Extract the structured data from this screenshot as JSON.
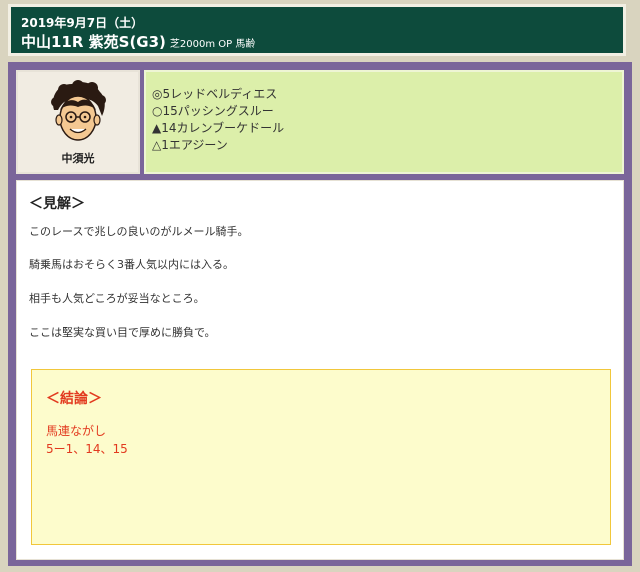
{
  "header": {
    "date": "2019年9月7日（土）",
    "race_title": "中山11R 紫苑S(G3)",
    "race_sub": "芝2000m OP 馬齢"
  },
  "tipster": {
    "name": "中須光"
  },
  "picks": [
    "◎5レッドベルディエス",
    "○15パッシングスルー",
    "▲14カレンブーケドール",
    "△1エアジーン"
  ],
  "analysis": {
    "title": "＜見解＞",
    "paragraphs": [
      "このレースで兆しの良いのがルメール騎手。",
      "騎乗馬はおそらく3番人気以内には入る。",
      "相手も人気どころが妥当なところ。",
      "ここは堅実な買い目で厚めに勝負で。"
    ]
  },
  "conclusion": {
    "title": "＜結論＞",
    "bet_type": "馬連ながし",
    "numbers": "5ー1、14、15"
  },
  "colors": {
    "header_bg": "#0d4b3c",
    "frame_purple": "#7a659a",
    "picks_bg": "#dcefaa",
    "conclusion_bg": "#fdfccc",
    "conclusion_text": "#e23a1f"
  }
}
